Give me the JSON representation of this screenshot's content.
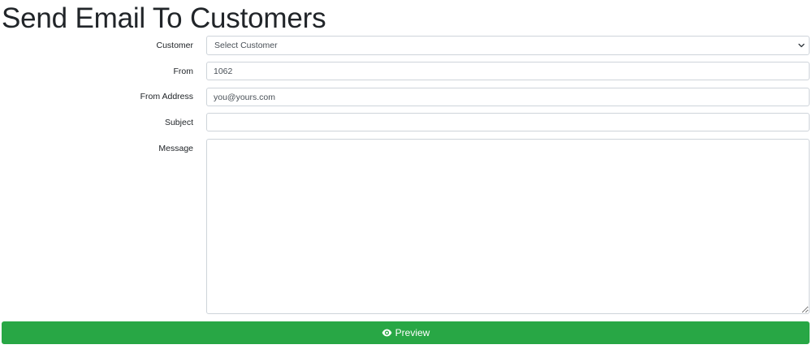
{
  "page": {
    "title": "Send Email To Customers"
  },
  "form": {
    "customer": {
      "label": "Customer",
      "selected": "Select Customer"
    },
    "from": {
      "label": "From",
      "value": "1062"
    },
    "from_address": {
      "label": "From Address",
      "value": "you@yours.com"
    },
    "subject": {
      "label": "Subject",
      "value": ""
    },
    "message": {
      "label": "Message",
      "value": ""
    }
  },
  "actions": {
    "preview_label": "Preview",
    "preview_icon": "eye-icon"
  },
  "colors": {
    "accent": "#28a745",
    "border": "#ced4da"
  }
}
